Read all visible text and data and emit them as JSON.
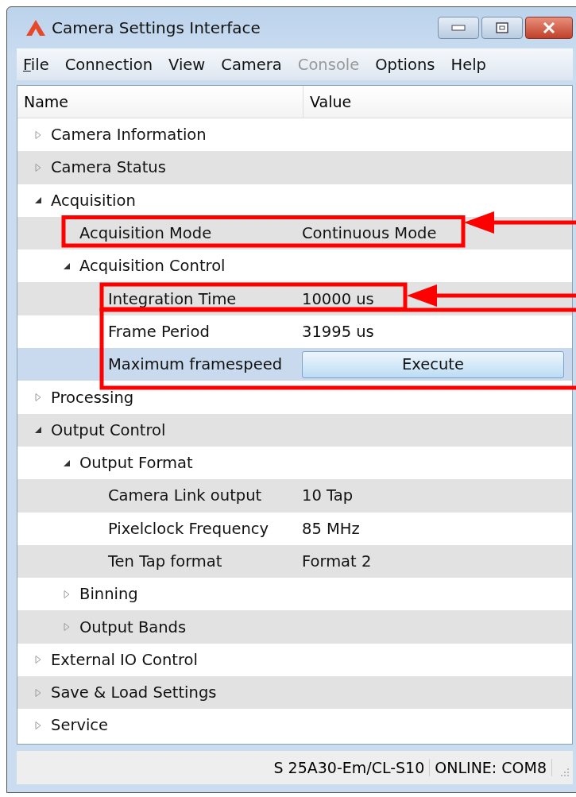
{
  "window": {
    "title": "Camera Settings Interface"
  },
  "menu": [
    {
      "label": "File",
      "disabled": false,
      "mnemonic": true
    },
    {
      "label": "Connection",
      "disabled": false,
      "mnemonic": false
    },
    {
      "label": "View",
      "disabled": false,
      "mnemonic": false
    },
    {
      "label": "Camera",
      "disabled": false,
      "mnemonic": false
    },
    {
      "label": "Console",
      "disabled": true,
      "mnemonic": false
    },
    {
      "label": "Options",
      "disabled": false,
      "mnemonic": false
    },
    {
      "label": "Help",
      "disabled": false,
      "mnemonic": false
    }
  ],
  "columns": [
    "Name",
    "Value"
  ],
  "tree": [
    {
      "name": "Camera Information",
      "expanded": false,
      "selected": false
    },
    {
      "name": "Camera Status",
      "expanded": false,
      "selected": false
    },
    {
      "name": "Acquisition",
      "expanded": true,
      "selected": false,
      "children": [
        {
          "name": "Acquisition Mode",
          "value": "Continuous Mode",
          "selected": false
        },
        {
          "name": "Acquisition Control",
          "expanded": true,
          "selected": false,
          "children": [
            {
              "name": "Integration Time",
              "value": "10000 us",
              "selected": false
            },
            {
              "name": "Frame Period",
              "value": "31995 us",
              "selected": false
            },
            {
              "name": "Maximum framespeed",
              "kind": "button",
              "value": "Execute",
              "selected": true
            }
          ]
        }
      ]
    },
    {
      "name": "Processing",
      "expanded": false,
      "selected": false
    },
    {
      "name": "Output Control",
      "expanded": true,
      "selected": false,
      "children": [
        {
          "name": "Output Format",
          "expanded": true,
          "selected": false,
          "children": [
            {
              "name": "Camera Link output",
              "value": "10 Tap",
              "selected": false
            },
            {
              "name": "Pixelclock Frequency",
              "value": "85 MHz",
              "selected": false
            },
            {
              "name": "Ten Tap format",
              "value": "Format 2",
              "selected": false
            }
          ]
        },
        {
          "name": "Binning",
          "expanded": false,
          "selected": false
        },
        {
          "name": "Output Bands",
          "expanded": false,
          "selected": false
        }
      ]
    },
    {
      "name": "External IO Control",
      "expanded": false,
      "selected": false
    },
    {
      "name": "Save & Load Settings",
      "expanded": false,
      "selected": false
    },
    {
      "name": "Service",
      "expanded": false,
      "selected": false
    }
  ],
  "status_bar": [
    "S 25A30-Em/CL-S10",
    "ONLINE: COM8"
  ]
}
